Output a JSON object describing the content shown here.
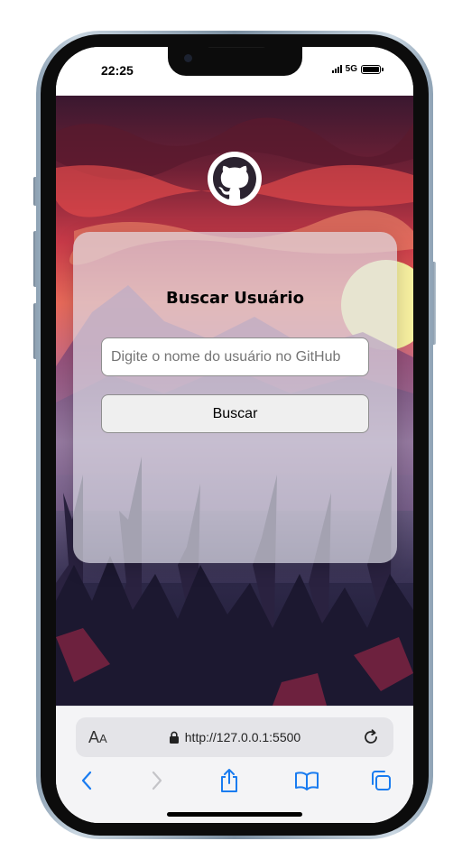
{
  "status_bar": {
    "time": "22:25",
    "network": "5G",
    "battery_level": 1.0
  },
  "page": {
    "logo_icon": "github-icon",
    "title": "Buscar Usuário",
    "search_placeholder": "Digite o nome do usuário no GitHub",
    "search_value": "",
    "search_button_label": "Buscar"
  },
  "browser": {
    "text_size_label": "A",
    "text_size_label_small": "A",
    "url": "http://127.0.0.1:5500",
    "icons": [
      "lock-icon",
      "reload-icon",
      "back-icon",
      "forward-icon",
      "share-icon",
      "bookmarks-icon",
      "tabs-icon"
    ]
  },
  "colors": {
    "ios_blue": "#1a7cf0",
    "card_bg": "#dedee8"
  }
}
